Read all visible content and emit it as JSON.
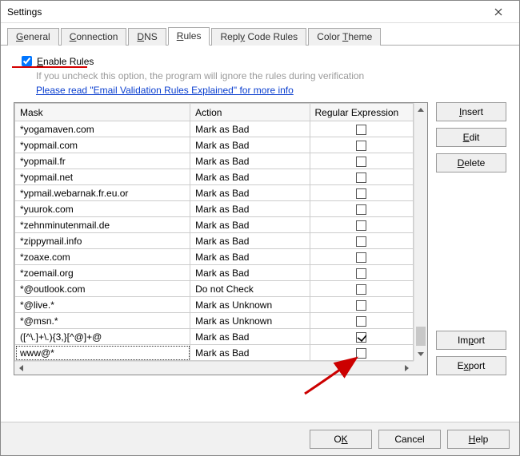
{
  "window": {
    "title": "Settings"
  },
  "tabs": [
    {
      "label_pre": "",
      "accel": "G",
      "label_post": "eneral"
    },
    {
      "label_pre": "",
      "accel": "C",
      "label_post": "onnection"
    },
    {
      "label_pre": "",
      "accel": "D",
      "label_post": "NS"
    },
    {
      "label_pre": "",
      "accel": "R",
      "label_post": "ules"
    },
    {
      "label_pre": "Repl",
      "accel": "y",
      "label_post": " Code Rules"
    },
    {
      "label_pre": "Color ",
      "accel": "T",
      "label_post": "heme"
    }
  ],
  "active_tab_index": 3,
  "enable": {
    "checked": true,
    "accel": "E",
    "label_post": "nable Rules"
  },
  "hint_text": "If you uncheck this option, the program will ignore the rules during verification",
  "link_text": "Please read \"Email Validation Rules Explained\" for more info",
  "columns": {
    "mask": "Mask",
    "action": "Action",
    "regex": "Regular Expression"
  },
  "rows": [
    {
      "mask": "*yogamaven.com",
      "action": "Mark as Bad",
      "regex": false
    },
    {
      "mask": "*yopmail.com",
      "action": "Mark as Bad",
      "regex": false
    },
    {
      "mask": "*yopmail.fr",
      "action": "Mark as Bad",
      "regex": false
    },
    {
      "mask": "*yopmail.net",
      "action": "Mark as Bad",
      "regex": false
    },
    {
      "mask": "*ypmail.webarnak.fr.eu.or",
      "action": "Mark as Bad",
      "regex": false
    },
    {
      "mask": "*yuurok.com",
      "action": "Mark as Bad",
      "regex": false
    },
    {
      "mask": "*zehnminutenmail.de",
      "action": "Mark as Bad",
      "regex": false
    },
    {
      "mask": "*zippymail.info",
      "action": "Mark as Bad",
      "regex": false
    },
    {
      "mask": "*zoaxe.com",
      "action": "Mark as Bad",
      "regex": false
    },
    {
      "mask": "*zoemail.org",
      "action": "Mark as Bad",
      "regex": false
    },
    {
      "mask": "*@outlook.com",
      "action": "Do not Check",
      "regex": false
    },
    {
      "mask": "*@live.*",
      "action": "Mark as Unknown",
      "regex": false
    },
    {
      "mask": "*@msn.*",
      "action": "Mark as Unknown",
      "regex": false
    },
    {
      "mask": "([^\\.]+\\.){3,}[^@]+@",
      "action": "Mark as Bad",
      "regex": true
    },
    {
      "mask": "www@*",
      "action": "Mark as Bad",
      "regex": false
    }
  ],
  "buttons": {
    "insert_a": "I",
    "insert_b": "nsert",
    "edit_a": "E",
    "edit_b": "dit",
    "delete_a": "D",
    "delete_b": "elete",
    "import_a": "Im",
    "import_u": "p",
    "import_b": "ort",
    "export_a": "E",
    "export_u": "x",
    "export_b": "port"
  },
  "footer": {
    "ok_a": "O",
    "ok_u": "K",
    "cancel": "Cancel",
    "help_a": "",
    "help_u": "H",
    "help_b": "elp"
  }
}
